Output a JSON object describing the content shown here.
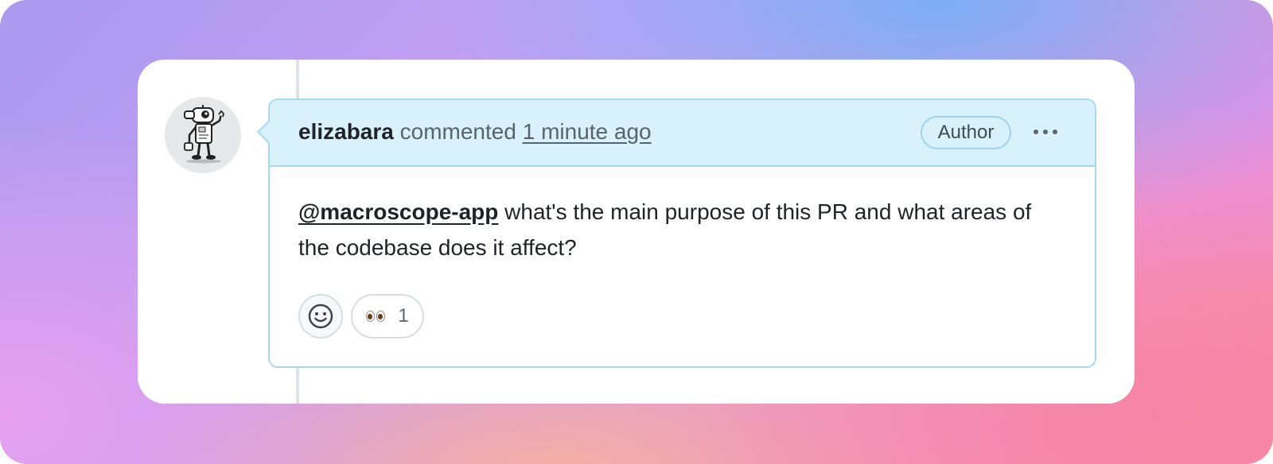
{
  "comment": {
    "author": "elizabara",
    "action": "commented",
    "timestamp": "1 minute ago",
    "badge": "Author",
    "more_icon": "kebab-horizontal-icon",
    "mention": "@macroscope-app",
    "body_text": "what's the main purpose of this PR and what areas of the codebase does it affect?",
    "avatar_icon": "robot-avatar-icon"
  },
  "reactions": {
    "add_icon": "smiley-icon",
    "items": [
      {
        "icon": "eyes-icon",
        "count": "1"
      }
    ]
  },
  "colors": {
    "header_bg": "#d8f1fb",
    "border": "#a8d8f0",
    "text": "#1f2328",
    "muted": "#59636e"
  }
}
